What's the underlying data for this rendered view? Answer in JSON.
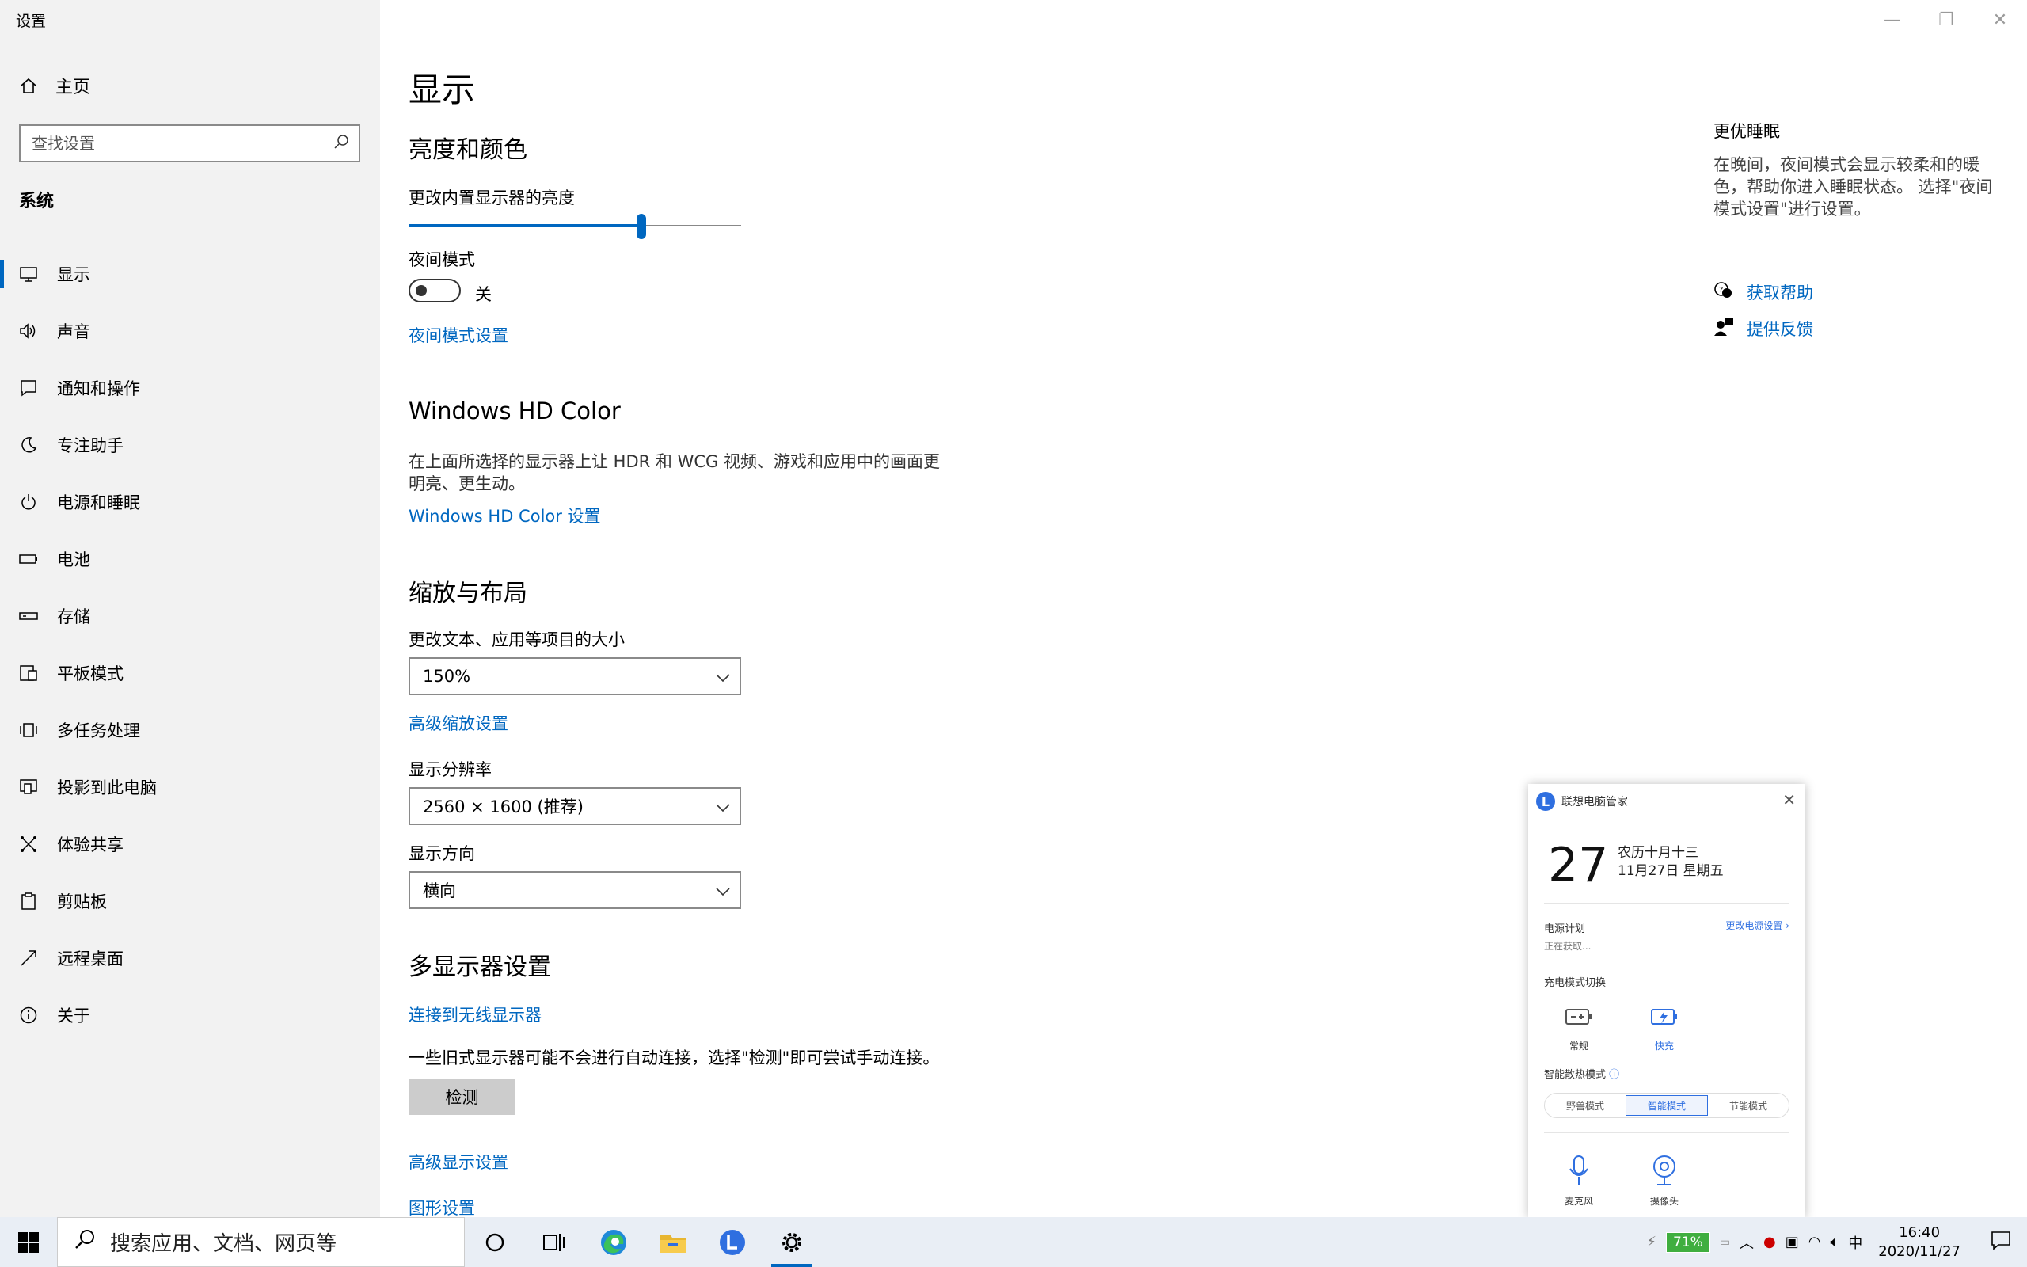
{
  "window": {
    "title": "设置",
    "controls": {
      "minimize": "—",
      "restore": "❐",
      "close": "✕"
    }
  },
  "sidebar": {
    "home_label": "主页",
    "search_placeholder": "查找设置",
    "section_label": "系统",
    "items": [
      {
        "label": "显示",
        "icon": "monitor-icon",
        "active": true
      },
      {
        "label": "声音",
        "icon": "speaker-icon"
      },
      {
        "label": "通知和操作",
        "icon": "notification-icon"
      },
      {
        "label": "专注助手",
        "icon": "moon-icon"
      },
      {
        "label": "电源和睡眠",
        "icon": "power-icon"
      },
      {
        "label": "电池",
        "icon": "battery-icon"
      },
      {
        "label": "存储",
        "icon": "storage-icon"
      },
      {
        "label": "平板模式",
        "icon": "tablet-icon"
      },
      {
        "label": "多任务处理",
        "icon": "multitask-icon"
      },
      {
        "label": "投影到此电脑",
        "icon": "project-icon"
      },
      {
        "label": "体验共享",
        "icon": "share-icon"
      },
      {
        "label": "剪贴板",
        "icon": "clipboard-icon"
      },
      {
        "label": "远程桌面",
        "icon": "remote-icon"
      },
      {
        "label": "关于",
        "icon": "info-icon"
      }
    ]
  },
  "content": {
    "page_title": "显示",
    "brightness": {
      "heading": "亮度和颜色",
      "label": "更改内置显示器的亮度",
      "value": 0.7
    },
    "night_light": {
      "label": "夜间模式",
      "state_text": "关",
      "settings_link": "夜间模式设置"
    },
    "hdr": {
      "heading": "Windows HD Color",
      "description": "在上面所选择的显示器上让 HDR 和 WCG 视频、游戏和应用中的画面更明亮、更生动。",
      "link": "Windows HD Color 设置"
    },
    "scale": {
      "heading": "缩放与布局",
      "text_size_label": "更改文本、应用等项目的大小",
      "text_size_value": "150%",
      "advanced_link": "高级缩放设置",
      "resolution_label": "显示分辨率",
      "resolution_value": "2560 × 1600 (推荐)",
      "orientation_label": "显示方向",
      "orientation_value": "横向"
    },
    "multi": {
      "heading": "多显示器设置",
      "wireless_link": "连接到无线显示器",
      "description": "一些旧式显示器可能不会进行自动连接，选择\"检测\"即可尝试手动连接。",
      "detect_button": "检测",
      "advanced_display_link": "高级显示设置",
      "graphics_link": "图形设置"
    }
  },
  "right_panel": {
    "heading": "更优睡眠",
    "description": "在晚间，夜间模式会显示较柔和的暖色，帮助你进入睡眠状态。 选择\"夜间模式设置\"进行设置。",
    "help_link": "获取帮助",
    "feedback_link": "提供反馈"
  },
  "lenovo": {
    "title": "联想电脑管家",
    "day": "27",
    "lunar": "农历十月十三",
    "date": "11月27日 星期五",
    "power_plan_label": "电源计划",
    "power_plan_link": "更改电源设置",
    "power_plan_status": "正在获取...",
    "charge_label": "充电模式切换",
    "charge_normal": "常规",
    "charge_fast": "快充",
    "cooling_label": "智能散热模式",
    "cooling_modes": [
      "野兽模式",
      "智能模式",
      "节能模式"
    ],
    "mic_label": "麦克风",
    "camera_label": "摄像头"
  },
  "taskbar": {
    "search_placeholder": "搜索应用、文档、网页等",
    "battery_percent": "71%",
    "ime": "中",
    "time": "16:40",
    "date": "2020/11/27"
  },
  "colors": {
    "accent": "#0067c0",
    "sidebar_bg": "#f2f2f2",
    "taskbar_bg": "#e9eef5"
  }
}
